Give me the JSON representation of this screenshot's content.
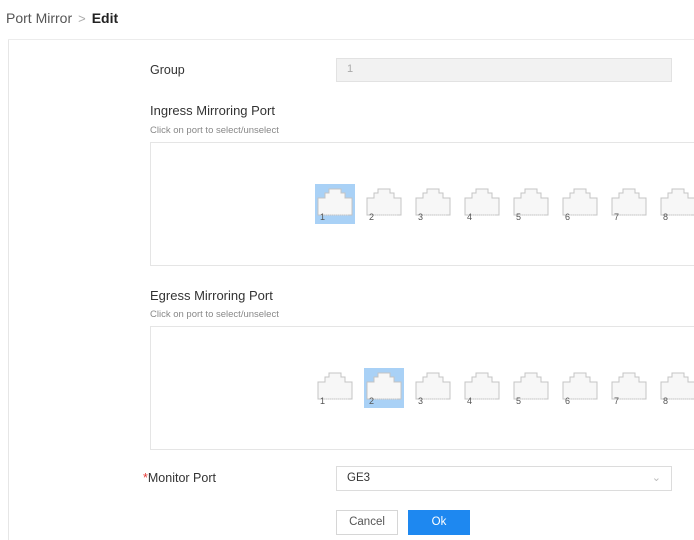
{
  "breadcrumb": {
    "parent": "Port Mirror",
    "separator": ">",
    "current": "Edit"
  },
  "group": {
    "label": "Group",
    "value": "1"
  },
  "ingress": {
    "title": "Ingress Mirroring Port",
    "hint": "Click on port to select/unselect",
    "ports": [
      "1",
      "2",
      "3",
      "4",
      "5",
      "6",
      "7",
      "8"
    ],
    "selected": [
      "1"
    ]
  },
  "egress": {
    "title": "Egress Mirroring Port",
    "hint": "Click on port to select/unselect",
    "ports": [
      "1",
      "2",
      "3",
      "4",
      "5",
      "6",
      "7",
      "8"
    ],
    "selected": [
      "2"
    ]
  },
  "monitor": {
    "required_mark": "*",
    "label": "Monitor Port",
    "value": "GE3",
    "chevron": "chevron-down-icon"
  },
  "actions": {
    "cancel_label": "Cancel",
    "ok_label": "Ok"
  },
  "colors": {
    "accent": "#1e88f0",
    "port_selected_bg": "#a9d1f6",
    "required": "#e53935"
  }
}
